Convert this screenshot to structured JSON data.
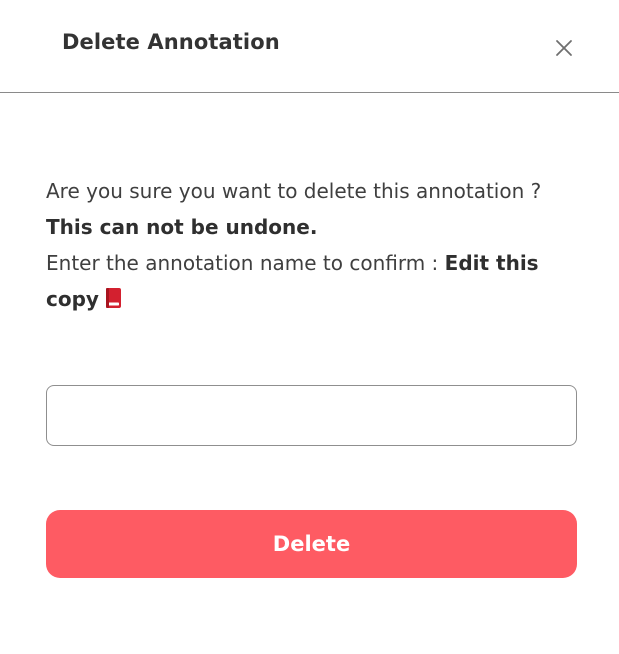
{
  "dialog": {
    "title": "Delete Annotation",
    "close_icon": "close-icon"
  },
  "message": {
    "line1": "Are you sure you want to delete this annotation ?",
    "warning": "This can not be undone.",
    "confirm_prompt": "Enter the annotation name to confirm :",
    "annotation_name": "Edit this copy",
    "annotation_icon": "red-book-icon"
  },
  "confirm_input": {
    "value": "",
    "placeholder": ""
  },
  "actions": {
    "delete_label": "Delete"
  },
  "colors": {
    "delete_button": "#fe5b63",
    "divider": "#8a8a8a",
    "book_icon": "#d3202f"
  }
}
